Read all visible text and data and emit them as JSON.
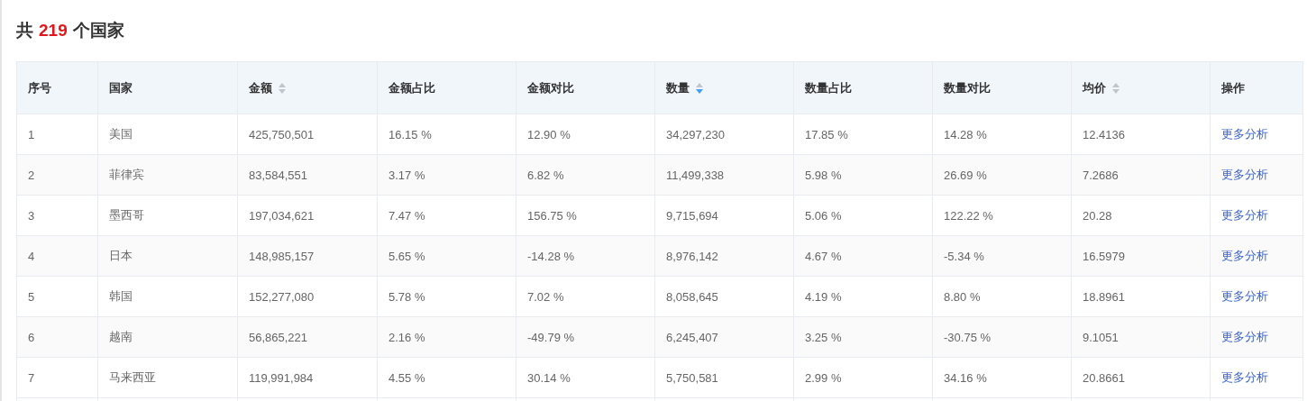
{
  "heading": {
    "prefix": "共",
    "count": "219",
    "suffix": "个国家"
  },
  "table": {
    "columns": [
      {
        "label": "序号"
      },
      {
        "label": "国家"
      },
      {
        "label": "金额",
        "sortable": true,
        "sorted_descending": false
      },
      {
        "label": "金额占比"
      },
      {
        "label": "金额对比"
      },
      {
        "label": "数量",
        "sortable": true,
        "sorted_descending": true
      },
      {
        "label": "数量占比"
      },
      {
        "label": "数量对比"
      },
      {
        "label": "均价",
        "sortable": true,
        "sorted_descending": false
      },
      {
        "label": "操作"
      }
    ],
    "rows": [
      {
        "cells": [
          "1",
          "美国",
          "425,750,501",
          "16.15 %",
          "12.90 %",
          "34,297,230",
          "17.85 %",
          "14.28 %",
          "12.4136"
        ],
        "action": "更多分析"
      },
      {
        "cells": [
          "2",
          "菲律宾",
          "83,584,551",
          "3.17 %",
          "6.82 %",
          "11,499,338",
          "5.98 %",
          "26.69 %",
          "7.2686"
        ],
        "action": "更多分析"
      },
      {
        "cells": [
          "3",
          "墨西哥",
          "197,034,621",
          "7.47 %",
          "156.75 %",
          "9,715,694",
          "5.06 %",
          "122.22 %",
          "20.28"
        ],
        "action": "更多分析"
      },
      {
        "cells": [
          "4",
          "日本",
          "148,985,157",
          "5.65 %",
          "-14.28 %",
          "8,976,142",
          "4.67 %",
          "-5.34 %",
          "16.5979"
        ],
        "action": "更多分析"
      },
      {
        "cells": [
          "5",
          "韩国",
          "152,277,080",
          "5.78 %",
          "7.02 %",
          "8,058,645",
          "4.19 %",
          "8.80 %",
          "18.8961"
        ],
        "action": "更多分析"
      },
      {
        "cells": [
          "6",
          "越南",
          "56,865,221",
          "2.16 %",
          "-49.79 %",
          "6,245,407",
          "3.25 %",
          "-30.75 %",
          "9.1051"
        ],
        "action": "更多分析"
      },
      {
        "cells": [
          "7",
          "马来西亚",
          "119,991,984",
          "4.55 %",
          "30.14 %",
          "5,750,581",
          "2.99 %",
          "34.16 %",
          "20.8661"
        ],
        "action": "更多分析"
      }
    ]
  }
}
